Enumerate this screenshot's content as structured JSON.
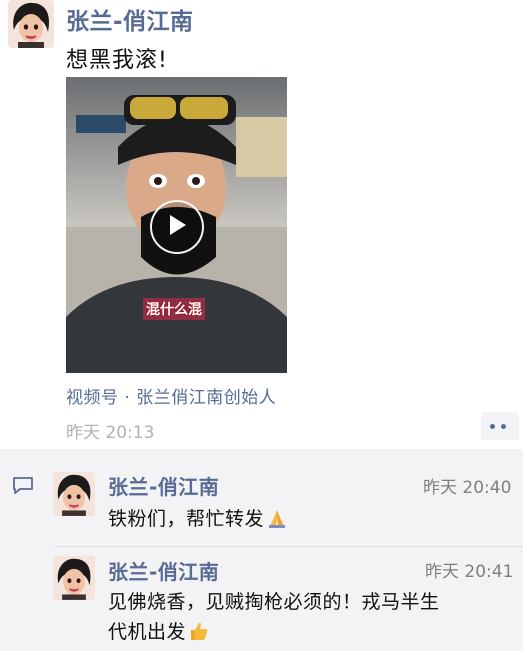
{
  "post": {
    "author": "张兰-俏江南",
    "text": "想黑我滚!",
    "video_caption": "混什么混",
    "channel": "视频号 · 张兰俏江南创始人",
    "time": "昨天 20:13"
  },
  "comments": [
    {
      "name": "张兰-俏江南",
      "time": "昨天 20:40",
      "text": "铁粉们，帮忙转发",
      "emoji": "folded-hands"
    },
    {
      "name": "张兰-俏江南",
      "time": "昨天 20:41",
      "text_line1": "见佛烧香，见贼掏枪必须的！戎马半生",
      "text_line2": "代机出发",
      "emoji": "thumbs-up"
    }
  ],
  "icons": [
    "avatar",
    "play-icon",
    "more-dots-icon",
    "comment-icon",
    "folded-hands-emoji",
    "thumbs-up-emoji"
  ],
  "colors": {
    "link": "#576b95",
    "comment_bg": "#f3f3f5",
    "timestamp": "#b2b2b2"
  }
}
